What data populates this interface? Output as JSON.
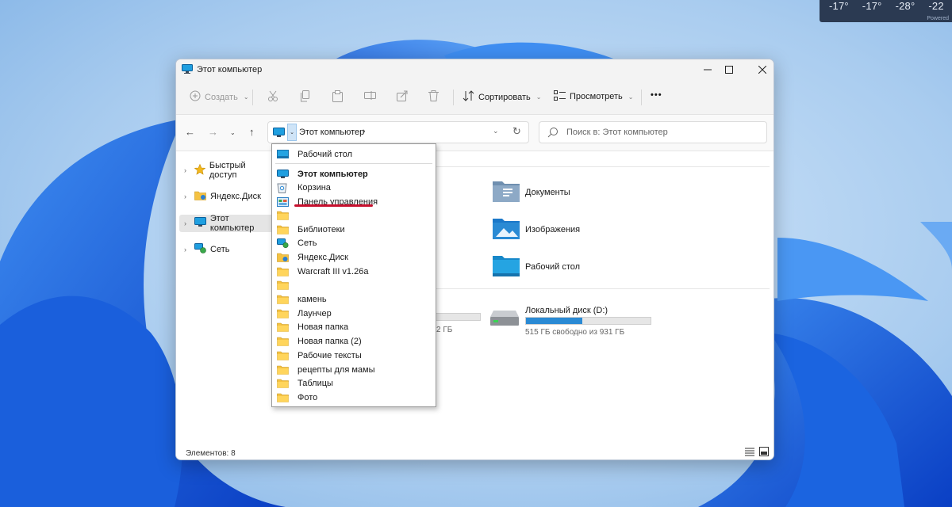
{
  "weather": {
    "temps": [
      "-17°",
      "-17°",
      "-28°",
      "-22"
    ],
    "powered": "Powered"
  },
  "window": {
    "title": "Этот компьютер",
    "toolbar": {
      "create": "Создать",
      "sort": "Сортировать",
      "view": "Просмотреть",
      "more": "•••"
    },
    "address": {
      "path": "Этот компьютер",
      "search_placeholder": "Поиск в: Этот компьютер"
    },
    "sidebar": {
      "items": [
        {
          "label": "Быстрый доступ",
          "icon": "star-icon"
        },
        {
          "label": "Яндекс.Диск",
          "icon": "yandex-disk-icon"
        },
        {
          "label": "Этот компьютер",
          "icon": "computer-icon",
          "selected": true
        },
        {
          "label": "Сеть",
          "icon": "network-icon"
        }
      ]
    },
    "folders": [
      {
        "label": "Документы",
        "icon": "documents-folder-icon"
      },
      {
        "label": "Изображения",
        "icon": "pictures-folder-icon"
      },
      {
        "label": "Рабочий стол",
        "icon": "desktop-folder-icon"
      }
    ],
    "drives": [
      {
        "partial_text": "2 ГБ"
      },
      {
        "label": "Локальный диск (D:)",
        "free": "515 ГБ свободно из 931 ГБ",
        "used_fraction": 0.45
      }
    ],
    "status": "Элементов: 8"
  },
  "dropdown": {
    "items": [
      {
        "label": "Рабочий стол",
        "icon": "desktop-icon"
      },
      {
        "label": "Этот компьютер",
        "icon": "computer-icon",
        "bold": true
      },
      {
        "label": "Корзина",
        "icon": "recycle-bin-icon"
      },
      {
        "label": "Панель управления",
        "icon": "control-panel-icon"
      },
      {
        "label": "",
        "icon": "folder-icon"
      },
      {
        "label": "Библиотеки",
        "icon": "folder-icon"
      },
      {
        "label": "Сеть",
        "icon": "network-icon"
      },
      {
        "label": "Яндекс.Диск",
        "icon": "yandex-disk-icon"
      },
      {
        "label": "Warcraft III v1.26a",
        "icon": "folder-icon"
      },
      {
        "label": "",
        "icon": "folder-icon"
      },
      {
        "label": "камень",
        "icon": "folder-icon"
      },
      {
        "label": "Лаунчер",
        "icon": "folder-icon"
      },
      {
        "label": "Новая папка",
        "icon": "folder-icon"
      },
      {
        "label": "Новая папка (2)",
        "icon": "folder-icon"
      },
      {
        "label": "Рабочие тексты",
        "icon": "folder-icon"
      },
      {
        "label": "рецепты для мамы",
        "icon": "folder-icon"
      },
      {
        "label": "Таблицы",
        "icon": "folder-icon"
      },
      {
        "label": "Фото",
        "icon": "folder-icon"
      }
    ]
  },
  "colors": {
    "accent": "#2a8ad4",
    "highlight": "#c8102e",
    "folder": "#f5c242"
  }
}
